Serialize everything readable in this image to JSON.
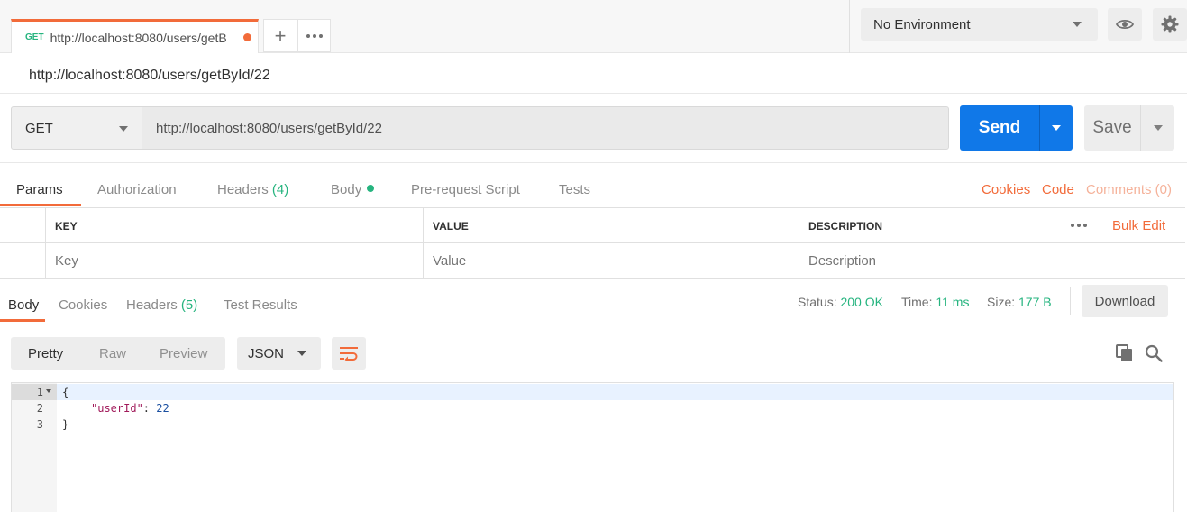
{
  "tab": {
    "method": "GET",
    "title": "http://localhost:8080/users/getB",
    "new_tab_symbol": "+"
  },
  "environment": {
    "selected": "No Environment"
  },
  "request": {
    "heading": "http://localhost:8080/users/getById/22",
    "method": "GET",
    "url": "http://localhost:8080/users/getById/22",
    "send_label": "Send",
    "save_label": "Save"
  },
  "request_tabs": [
    {
      "label": "Params"
    },
    {
      "label": "Authorization"
    },
    {
      "label": "Headers",
      "count": "(4)"
    },
    {
      "label": "Body"
    },
    {
      "label": "Pre-request Script"
    },
    {
      "label": "Tests"
    }
  ],
  "request_links": {
    "cookies": "Cookies",
    "code": "Code",
    "comments": "Comments (0)"
  },
  "params_table": {
    "headers": [
      "KEY",
      "VALUE",
      "DESCRIPTION"
    ],
    "placeholders": {
      "key": "Key",
      "value": "Value",
      "description": "Description"
    },
    "bulk_edit": "Bulk Edit"
  },
  "response_tabs": [
    {
      "label": "Body"
    },
    {
      "label": "Cookies"
    },
    {
      "label": "Headers",
      "count": "(5)"
    },
    {
      "label": "Test Results"
    }
  ],
  "response_status": {
    "status_label": "Status:",
    "status_value": "200 OK",
    "time_label": "Time:",
    "time_value": "11 ms",
    "size_label": "Size:",
    "size_value": "177 B",
    "download_label": "Download"
  },
  "view_modes": [
    "Pretty",
    "Raw",
    "Preview"
  ],
  "format": "JSON",
  "code": {
    "line_numbers": [
      "1",
      "2",
      "3"
    ],
    "open_brace": "{",
    "key": "\"userId\"",
    "colon": ": ",
    "value": "22",
    "close_brace": "}"
  },
  "colors": {
    "accent": "#f26b3a",
    "send": "#1078e8",
    "success": "#26b47f"
  }
}
